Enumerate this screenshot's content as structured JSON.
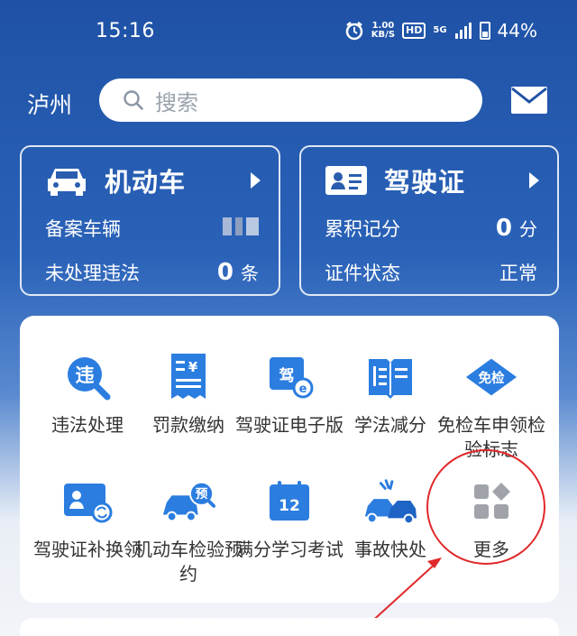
{
  "status_bar": {
    "time": "15:16",
    "net_speed_value": "1.00",
    "net_speed_unit": "KB/S",
    "hd": "HD",
    "network": "5G",
    "battery": "44%"
  },
  "header": {
    "city": "泸州",
    "search_placeholder": "搜索"
  },
  "vehicle_card": {
    "title": "机动车",
    "registered_label": "备案车辆",
    "violations_label": "未处理违法",
    "violations_value": "0",
    "violations_unit": "条"
  },
  "license_card": {
    "title": "驾驶证",
    "points_label": "累积记分",
    "points_value": "0",
    "points_unit": "分",
    "status_label": "证件状态",
    "status_value": "正常"
  },
  "services": [
    {
      "label": "违法处理",
      "icon": "violation-search-icon"
    },
    {
      "label": "罚款缴纳",
      "icon": "fine-receipt-icon"
    },
    {
      "label": "驾驶证电子版",
      "icon": "e-license-icon",
      "icon_text": "驾"
    },
    {
      "label": "学法减分",
      "icon": "book-icon"
    },
    {
      "label": "免检车申领检验标志",
      "icon": "inspection-exempt-icon",
      "icon_text": "免检"
    },
    {
      "label": "驾驶证补换领",
      "icon": "license-replace-icon"
    },
    {
      "label": "机动车检验预约",
      "icon": "inspection-booking-icon",
      "icon_text": "预"
    },
    {
      "label": "满分学习考试",
      "icon": "calendar-exam-icon",
      "icon_text": "12"
    },
    {
      "label": "事故快处",
      "icon": "accident-icon"
    },
    {
      "label": "更多",
      "icon": "more-grid-icon"
    }
  ],
  "colors": {
    "primary_blue": "#1f52a6",
    "icon_blue": "#2b7de0",
    "annotation_red": "#e0282a"
  }
}
